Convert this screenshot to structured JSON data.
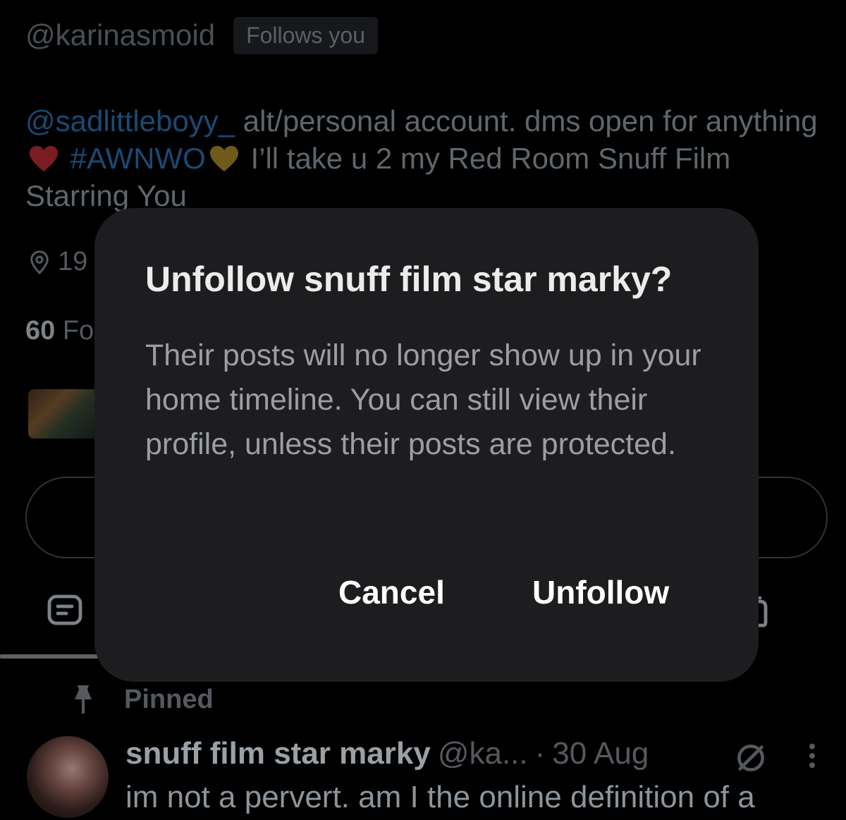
{
  "profile": {
    "handle": "@karinasmoid",
    "follows_badge": "Follows you",
    "bio": {
      "mention": "@sadlittleboyy_",
      "text1": " alt/personal account. dms open for anything",
      "hashtag": "#AWNWO",
      "text2": " I’ll take u 2 my Red Room Snuff Film Starring You"
    },
    "location_partial": "19",
    "followers_count": "60",
    "followers_partial": "Fo"
  },
  "pinned": {
    "label": "Pinned",
    "name": "snuff film star marky",
    "handle": "@ka...",
    "separator": "·",
    "date": "30 Aug",
    "text": "im not a pervert. am I the online definition of a"
  },
  "dialog": {
    "title": "Unfollow snuff film star marky?",
    "body": "Their posts will no longer show up in your home timeline. You can still view their profile, unless their posts are protected.",
    "cancel_label": "Cancel",
    "confirm_label": "Unfollow"
  },
  "colors": {
    "background": "#000000",
    "modal_bg": "#1d1d1f",
    "link_dim": "#1a4a73",
    "heart_red": "#7a1c22",
    "heart_gold": "#6f5a1c"
  },
  "icons": [
    "location-icon",
    "posts-tab-icon",
    "pin-icon",
    "grok-icon",
    "more-icon",
    "red-heart-emoji",
    "gold-heart-emoji"
  ]
}
